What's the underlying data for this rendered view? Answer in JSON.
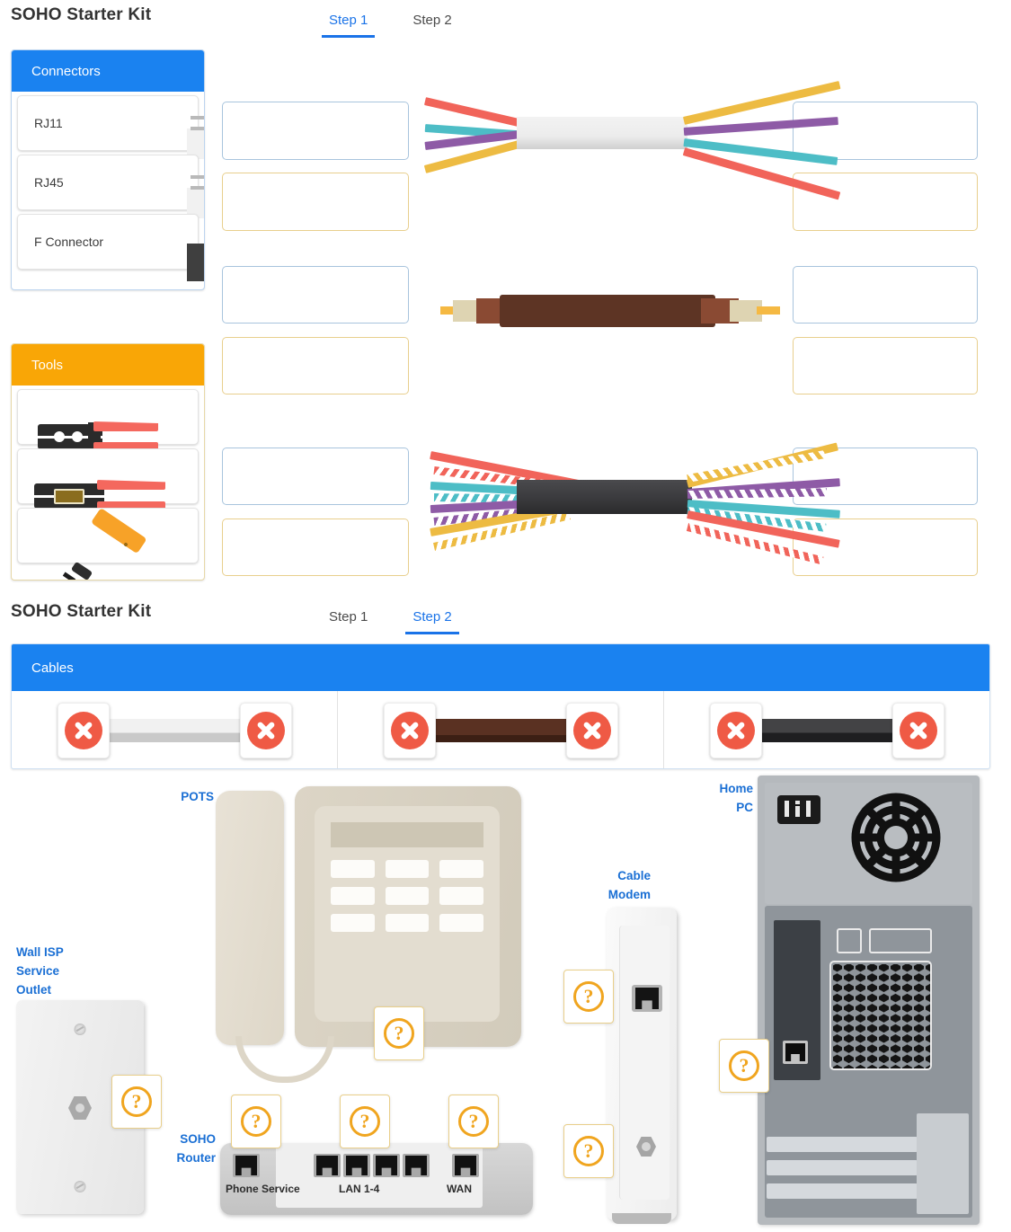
{
  "step1": {
    "title": "SOHO Starter Kit",
    "tabs": [
      {
        "label": "Step 1",
        "active": true
      },
      {
        "label": "Step 2",
        "active": false
      }
    ],
    "connectors_panel": {
      "header": "Connectors",
      "items": [
        {
          "label": "RJ11",
          "icon": "rj11-connector-icon"
        },
        {
          "label": "RJ45",
          "icon": "rj45-connector-icon"
        },
        {
          "label": "F Connector",
          "icon": "f-connector-icon"
        }
      ]
    },
    "tools_panel": {
      "header": "Tools",
      "items": [
        {
          "label": "",
          "icon": "crimping-tool-icon"
        },
        {
          "label": "",
          "icon": "wire-stripper-tool-icon"
        },
        {
          "label": "",
          "icon": "punch-down-tool-icon"
        }
      ]
    },
    "cable_rows": [
      {
        "name": "four-conductor-phone-cable",
        "jacket_color": "#ececec",
        "wire_colors": [
          "#f1645a",
          "#4dbdc6",
          "#8e5ba6",
          "#edbb42"
        ],
        "left_slots": [
          {
            "type": "connector",
            "border_color": "#a8c4dd",
            "value": ""
          },
          {
            "type": "tool",
            "border_color": "#e8cf8d",
            "value": ""
          }
        ],
        "right_slots": [
          {
            "type": "connector",
            "border_color": "#a8c4dd",
            "value": ""
          },
          {
            "type": "tool",
            "border_color": "#e8cf8d",
            "value": ""
          }
        ]
      },
      {
        "name": "coaxial-cable",
        "jacket_color": "#5d3424",
        "wire_colors": [
          "#f5b943",
          "#ded4b2",
          "#8a4a33"
        ],
        "left_slots": [
          {
            "type": "connector",
            "border_color": "#a8c4dd",
            "value": ""
          },
          {
            "type": "tool",
            "border_color": "#e8cf8d",
            "value": ""
          }
        ],
        "right_slots": [
          {
            "type": "connector",
            "border_color": "#a8c4dd",
            "value": ""
          },
          {
            "type": "tool",
            "border_color": "#e8cf8d",
            "value": ""
          }
        ]
      },
      {
        "name": "twisted-pair-utp-cable",
        "jacket_color": "#3a3a3d",
        "wire_colors": [
          "#f1645a",
          "#4dbdc6",
          "#8e5ba6",
          "#edbb42"
        ],
        "left_slots": [
          {
            "type": "connector",
            "border_color": "#a8c4dd",
            "value": ""
          },
          {
            "type": "tool",
            "border_color": "#e8cf8d",
            "value": ""
          }
        ],
        "right_slots": [
          {
            "type": "connector",
            "border_color": "#a8c4dd",
            "value": ""
          },
          {
            "type": "tool",
            "border_color": "#e8cf8d",
            "value": ""
          }
        ]
      }
    ]
  },
  "step2": {
    "title": "SOHO Starter Kit",
    "tabs": [
      {
        "label": "Step 1",
        "active": false
      },
      {
        "label": "Step 2",
        "active": true
      }
    ],
    "cables_panel": {
      "header": "Cables",
      "items": [
        {
          "name": "phone-cable",
          "color": "#e9e9e9",
          "remove_left": "remove",
          "remove_right": "remove"
        },
        {
          "name": "coax-cable",
          "color": "#5a3122",
          "remove_left": "remove",
          "remove_right": "remove"
        },
        {
          "name": "ethernet-cable",
          "color": "#2f2f31",
          "remove_left": "remove",
          "remove_right": "remove"
        }
      ]
    },
    "devices": [
      {
        "name": "wall-isp-service-outlet",
        "label": "Wall ISP\nService\nOutlet"
      },
      {
        "name": "pots-telephone",
        "label": "POTS"
      },
      {
        "name": "soho-router",
        "label": "SOHO\nRouter"
      },
      {
        "name": "cable-modem",
        "label": "Cable\nModem"
      },
      {
        "name": "home-pc",
        "label": "Home\nPC"
      }
    ],
    "device_labels": {
      "wall_outlet_line1": "Wall ISP",
      "wall_outlet_line2": "Service",
      "wall_outlet_line3": "Outlet",
      "pots": "POTS",
      "router_line1": "SOHO",
      "router_line2": "Router",
      "modem_line1": "Cable",
      "modem_line2": "Modem",
      "pc_line1": "Home",
      "pc_line2": "PC"
    },
    "router_ports": [
      {
        "caption": "Phone Service",
        "count": 1
      },
      {
        "caption": "LAN 1-4",
        "count": 4
      },
      {
        "caption": "WAN",
        "count": 1
      }
    ],
    "drop_targets": [
      {
        "name": "drop-wall-outlet-coax",
        "glyph": "?"
      },
      {
        "name": "drop-pots-phone-line",
        "glyph": "?"
      },
      {
        "name": "drop-router-phone-service",
        "glyph": "?"
      },
      {
        "name": "drop-router-lan",
        "glyph": "?"
      },
      {
        "name": "drop-router-wan",
        "glyph": "?"
      },
      {
        "name": "drop-modem-ethernet",
        "glyph": "?"
      },
      {
        "name": "drop-modem-coax",
        "glyph": "?"
      },
      {
        "name": "drop-pc-ethernet",
        "glyph": "?"
      }
    ]
  },
  "colors": {
    "accent_blue": "#1a82f0",
    "accent_amber": "#f9a606",
    "tab_active": "#1a73e8",
    "label_blue": "#1a6fd4",
    "remove_red": "#ef5a45"
  }
}
